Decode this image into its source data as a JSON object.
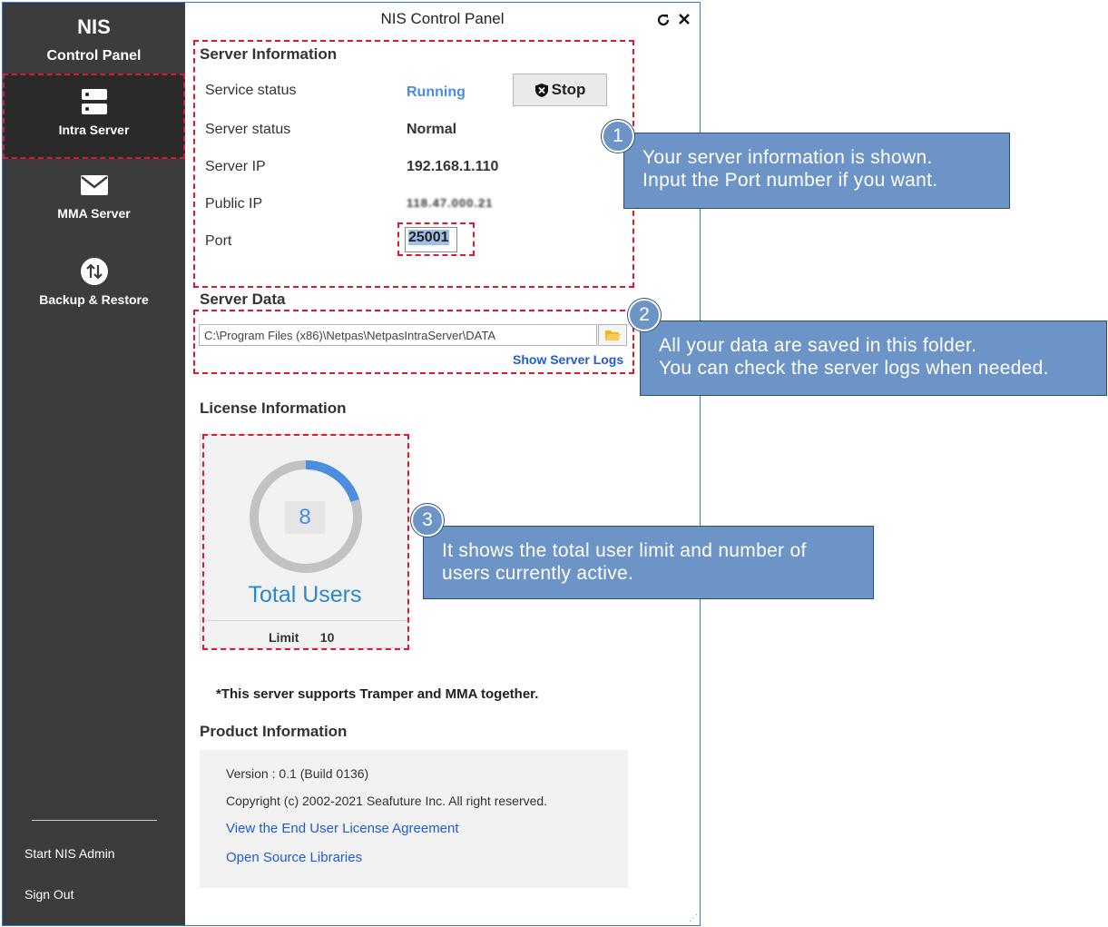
{
  "app": {
    "brand_title": "NIS",
    "brand_subtitle": "Control Panel",
    "window_title": "NIS Control Panel"
  },
  "sidebar": {
    "items": [
      {
        "label": "Intra Server",
        "icon": "server-icon",
        "active": true
      },
      {
        "label": "MMA Server",
        "icon": "mail-icon",
        "active": false
      },
      {
        "label": "Backup & Restore",
        "icon": "backup-restore-icon",
        "active": false
      }
    ],
    "bottom_links": [
      {
        "label": "Start NIS Admin"
      },
      {
        "label": "Sign Out"
      }
    ]
  },
  "server_info": {
    "title": "Server Information",
    "service_status_label": "Service status",
    "service_status_value": "Running",
    "stop_label": "Stop",
    "server_status_label": "Server status",
    "server_status_value": "Normal",
    "server_ip_label": "Server IP",
    "server_ip_value": "192.168.1.110",
    "public_ip_label": "Public IP",
    "public_ip_value": "118.47.000.21",
    "port_label": "Port",
    "port_value": "25001"
  },
  "server_data": {
    "title": "Server Data",
    "path": "C:\\Program Files (x86)\\Netpas\\NetpasIntraServer\\DATA",
    "show_logs_label": "Show Server Logs"
  },
  "license": {
    "title": "License Information",
    "active_users": "8",
    "total_users_label": "Total Users",
    "limit_label": "Limit",
    "limit_value": "10",
    "gauge_fraction": 0.2
  },
  "support_note": "*This server supports Tramper and MMA together.",
  "product": {
    "title": "Product Information",
    "version_label": "Version :",
    "version_value": "0.1 (Build 0136)",
    "copyright": "Copyright (c) 2002-2021 Seafuture Inc. All right reserved.",
    "eula_link": "View the End User License Agreement",
    "oss_link": "Open Source Libraries"
  },
  "callouts": [
    {
      "number": "1",
      "line1": "Your server information is shown.",
      "line2": "Input the Port number if you want."
    },
    {
      "number": "2",
      "line1": "All your data are saved in this folder.",
      "line2": "You can check the server logs when needed."
    },
    {
      "number": "3",
      "line1": "It shows the total user limit and number of",
      "line2": "users currently active."
    }
  ],
  "colors": {
    "sidebar": "#3c3c3c",
    "accent_blue": "#4b8de0",
    "callout": "#6d94c6",
    "highlight_red": "#e0182d"
  }
}
